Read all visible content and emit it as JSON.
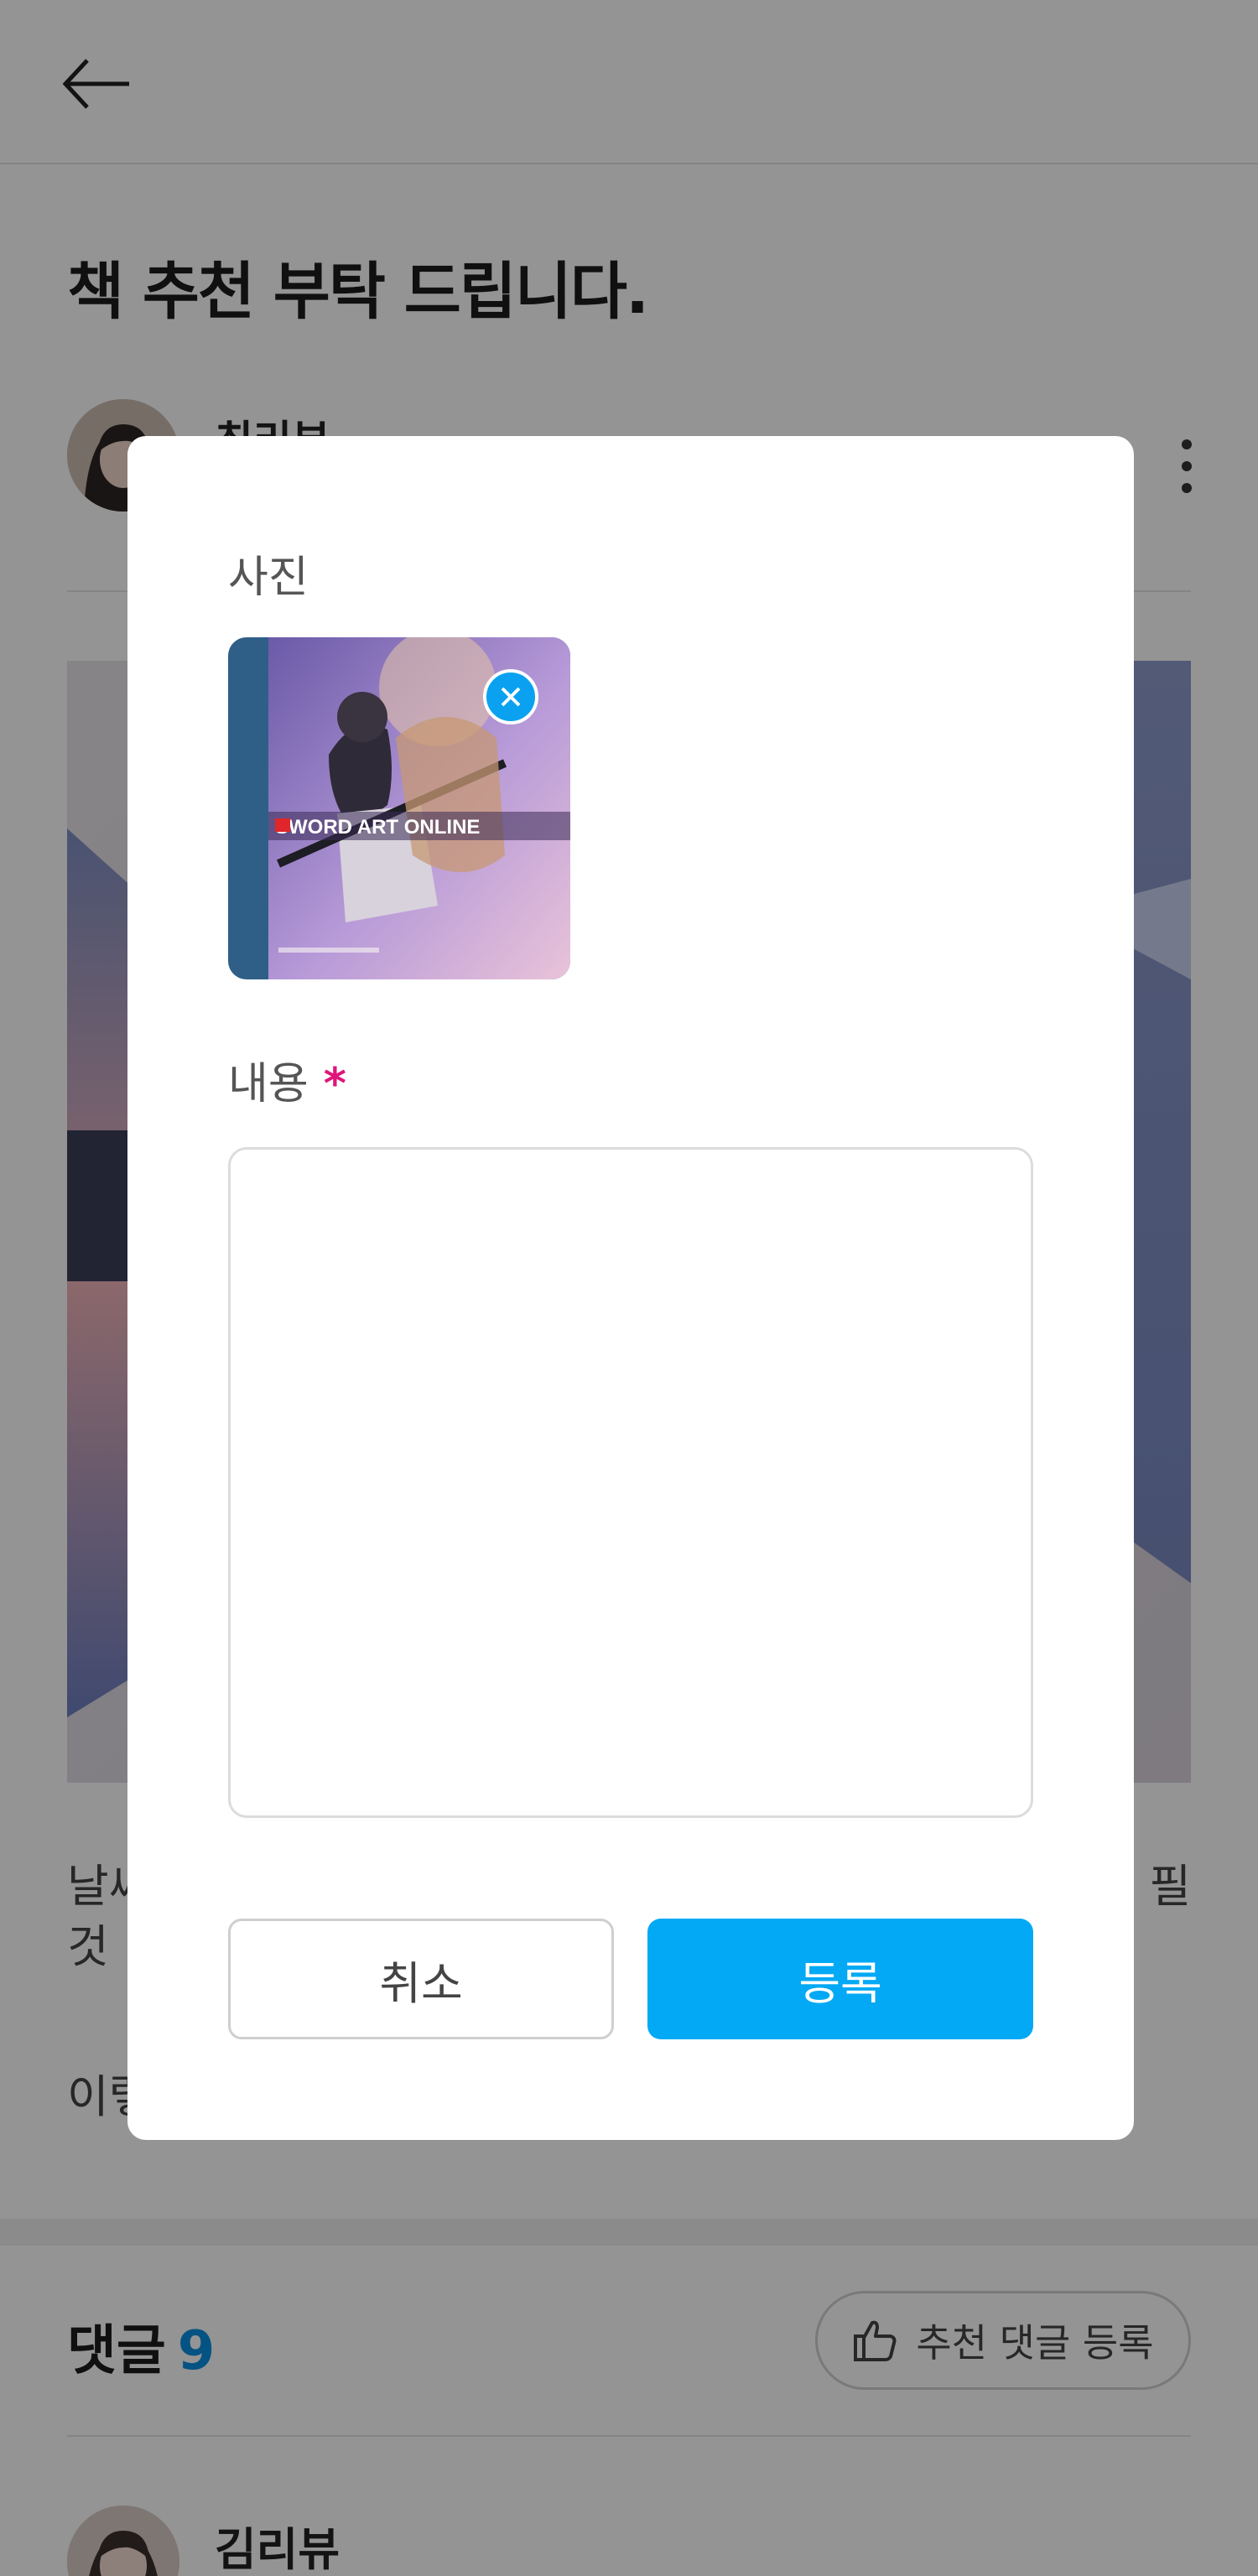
{
  "header": {
    "back_icon": "arrow-left-icon"
  },
  "post": {
    "title": "책 추천 부탁 드립니다.",
    "author_name": "최리뷰",
    "more_icon": "more-vertical-icon",
    "body_line_1": "날씨",
    "body_line_1_end": "필",
    "body_line_2": "것",
    "body_line_3": "이렇"
  },
  "comments": {
    "heading": "댓글",
    "count": "9",
    "recommend_button_label": "추천 댓글 등록",
    "recommend_icon": "thumbs-up-icon",
    "first_author": "김리뷰"
  },
  "modal": {
    "photo_label": "사진",
    "photo_remove_icon": "close-icon",
    "thumbnail_caption": "SWORD ART ONLINE",
    "content_label": "내용",
    "required_mark": "*",
    "content_value": "",
    "cancel_label": "취소",
    "submit_label": "등록"
  },
  "colors": {
    "accent": "#03a9f4",
    "required": "#e0157a",
    "count": "#0a8fe0",
    "overlay": "rgba(0,0,0,0.42)"
  }
}
